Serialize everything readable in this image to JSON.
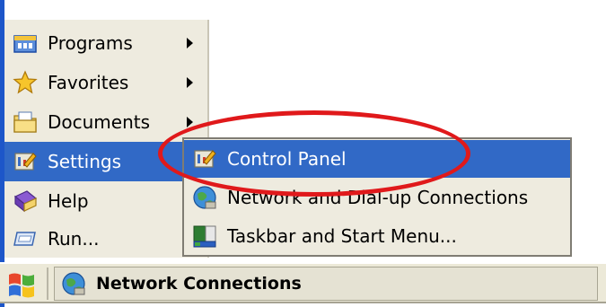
{
  "start_menu": {
    "items": [
      {
        "label": "Programs",
        "icon": "programs-icon",
        "has_submenu": true
      },
      {
        "label": "Favorites",
        "icon": "favorites-icon",
        "has_submenu": true
      },
      {
        "label": "Documents",
        "icon": "documents-icon",
        "has_submenu": true
      },
      {
        "label": "Settings",
        "icon": "settings-icon",
        "has_submenu": true,
        "active": true
      },
      {
        "label": "Help",
        "icon": "help-icon",
        "has_submenu": false
      },
      {
        "label": "Run...",
        "icon": "run-icon",
        "has_submenu": false
      }
    ]
  },
  "settings_submenu": {
    "items": [
      {
        "label": "Control Panel",
        "icon": "control-panel-icon",
        "active": true
      },
      {
        "label": "Network and Dial-up Connections",
        "icon": "network-icon"
      },
      {
        "label": "Taskbar and Start Menu...",
        "icon": "taskbar-icon"
      }
    ]
  },
  "taskbar": {
    "window_title": "Network Connections",
    "start_icon": "windows-flag-icon"
  },
  "colors": {
    "menu_bg": "#eeebdf",
    "highlight_bg": "#3169c6",
    "annotation_ring": "#e0191b",
    "taskbar_bg": "#ece9d8"
  }
}
